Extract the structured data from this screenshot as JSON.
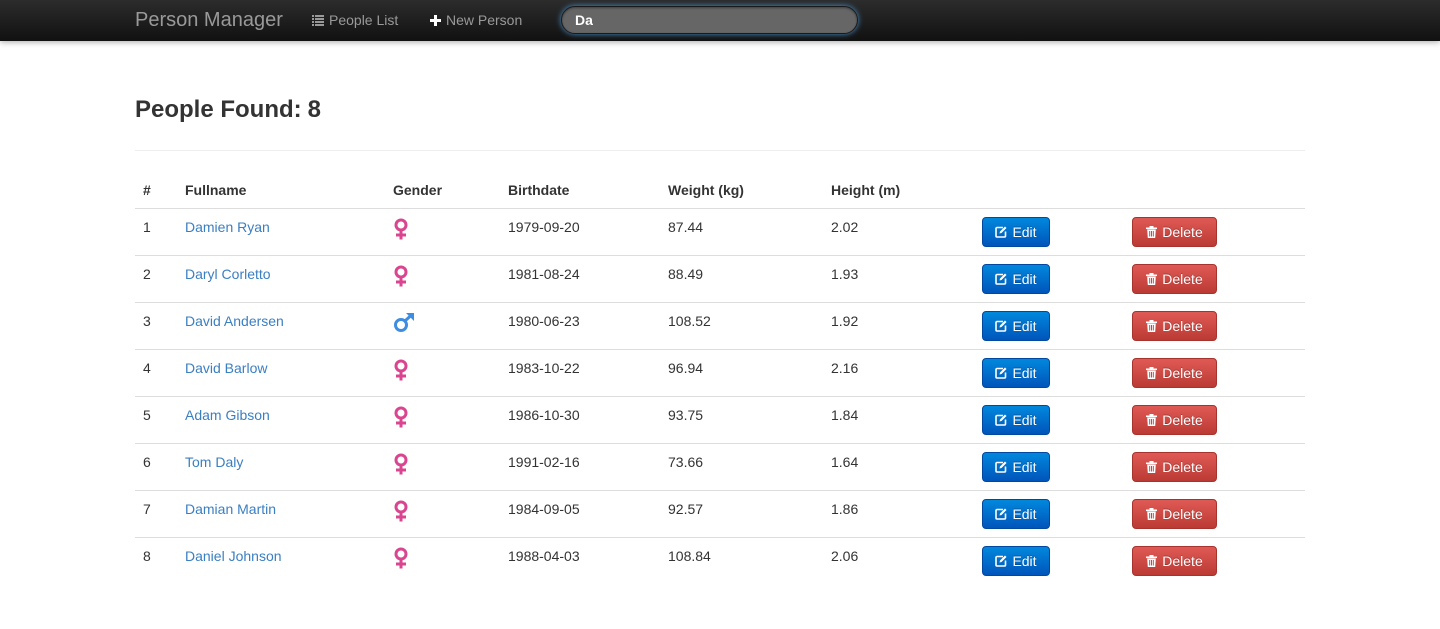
{
  "navbar": {
    "brand": "Person Manager",
    "people_list": "People List",
    "new_person": "New Person",
    "search_value": "Da"
  },
  "header": {
    "title_prefix": "People Found:",
    "count": "8"
  },
  "table": {
    "columns": [
      "#",
      "Fullname",
      "Gender",
      "Birthdate",
      "Weight (kg)",
      "Height (m)"
    ],
    "edit_label": "Edit",
    "delete_label": "Delete",
    "rows": [
      {
        "num": "1",
        "name": "Damien Ryan",
        "gender": "female",
        "birthdate": "1979-09-20",
        "weight": "87.44",
        "height": "2.02"
      },
      {
        "num": "2",
        "name": "Daryl Corletto",
        "gender": "female",
        "birthdate": "1981-08-24",
        "weight": "88.49",
        "height": "1.93"
      },
      {
        "num": "3",
        "name": "David Andersen",
        "gender": "male",
        "birthdate": "1980-06-23",
        "weight": "108.52",
        "height": "1.92"
      },
      {
        "num": "4",
        "name": "David Barlow",
        "gender": "female",
        "birthdate": "1983-10-22",
        "weight": "96.94",
        "height": "2.16"
      },
      {
        "num": "5",
        "name": "Adam Gibson",
        "gender": "female",
        "birthdate": "1986-10-30",
        "weight": "93.75",
        "height": "1.84"
      },
      {
        "num": "6",
        "name": "Tom Daly",
        "gender": "female",
        "birthdate": "1991-02-16",
        "weight": "73.66",
        "height": "1.64"
      },
      {
        "num": "7",
        "name": "Damian Martin",
        "gender": "female",
        "birthdate": "1984-09-05",
        "weight": "92.57",
        "height": "1.86"
      },
      {
        "num": "8",
        "name": "Daniel Johnson",
        "gender": "female",
        "birthdate": "1988-04-03",
        "weight": "108.84",
        "height": "2.06"
      }
    ]
  },
  "colors": {
    "female": "#d9468f",
    "male": "#3f8de0",
    "link": "#3a7fc1",
    "edit_button": "#0066cc",
    "delete_button": "#cc4a44"
  },
  "icons": {
    "people_list": "list-icon",
    "new_person": "plus-icon",
    "edit": "edit-icon",
    "delete": "trash-icon",
    "female": "female-icon",
    "male": "male-icon"
  }
}
